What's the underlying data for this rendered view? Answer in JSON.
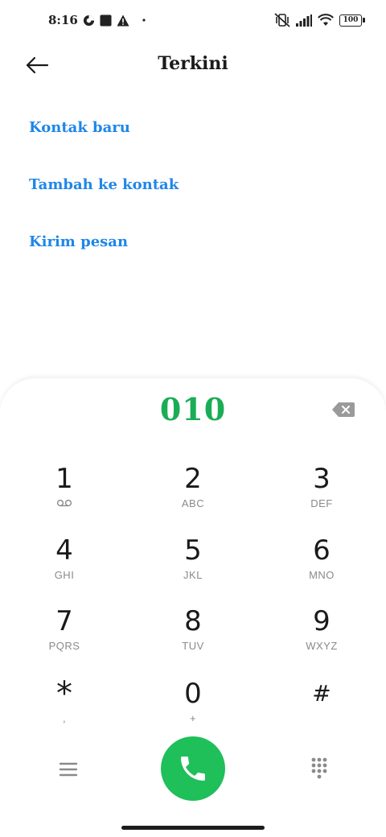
{
  "status_bar": {
    "time": "8:16",
    "battery": "100",
    "icons": [
      "privacy-indicator-icon",
      "app-notification-icon",
      "warning-icon",
      "dot-icon",
      "vibrate-off-icon",
      "signal-icon",
      "wifi-icon",
      "battery-icon"
    ]
  },
  "header": {
    "title": "Terkini",
    "back_icon": "arrow-left-icon"
  },
  "actions": [
    {
      "label": "Kontak baru"
    },
    {
      "label": "Tambah ke kontak"
    },
    {
      "label": "Kirim pesan"
    }
  ],
  "dialer": {
    "number": "010",
    "number_color": "#1aad55",
    "keys": [
      {
        "digit": "1",
        "letters": ""
      },
      {
        "digit": "2",
        "letters": "ABC"
      },
      {
        "digit": "3",
        "letters": "DEF"
      },
      {
        "digit": "4",
        "letters": "GHI"
      },
      {
        "digit": "5",
        "letters": "JKL"
      },
      {
        "digit": "6",
        "letters": "MNO"
      },
      {
        "digit": "7",
        "letters": "PQRS"
      },
      {
        "digit": "8",
        "letters": "TUV"
      },
      {
        "digit": "9",
        "letters": "WXYZ"
      },
      {
        "digit": "*",
        "letters": ","
      },
      {
        "digit": "0",
        "letters": "+"
      },
      {
        "digit": "#",
        "letters": ""
      }
    ],
    "call_color": "#1fbf5a"
  },
  "colors": {
    "accent_link": "#1f86e8",
    "background": "#ffffff"
  }
}
